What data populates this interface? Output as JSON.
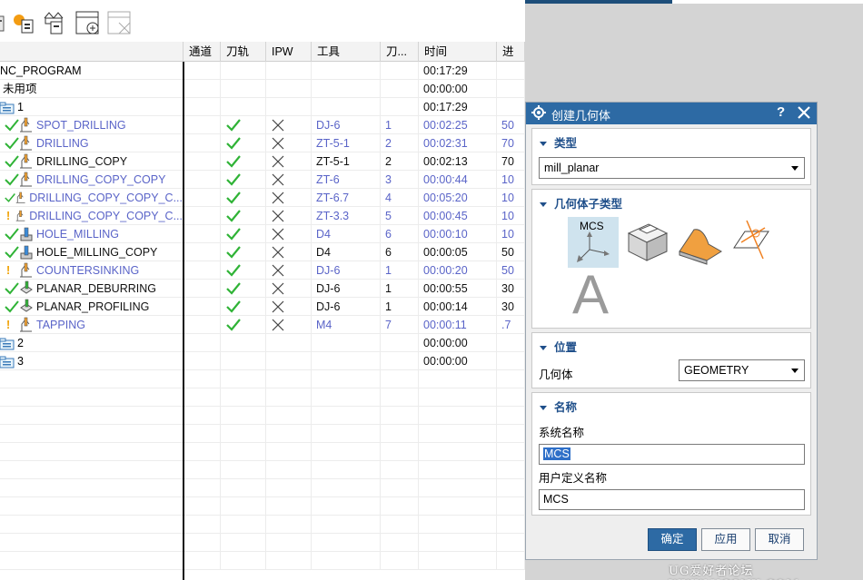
{
  "toolbar": {
    "buttons": [
      {
        "name": "program-view",
        "icon": "program-view-icon"
      },
      {
        "name": "machine-tool-view",
        "icon": "machine-tool-view-icon"
      },
      {
        "name": "geometry-view",
        "icon": "geometry-view-icon"
      },
      {
        "name": "create-geometry",
        "icon": "create-geometry-icon"
      },
      {
        "name": "delete",
        "icon": "delete-icon"
      }
    ]
  },
  "table": {
    "columns": [
      "",
      "通道",
      "刀轨",
      "IPW",
      "工具",
      "刀...",
      "时间",
      "进"
    ],
    "rows": [
      {
        "name": "NC_PROGRAM",
        "type": "root",
        "time": "00:17:29"
      },
      {
        "name": "未用项",
        "type": "unused",
        "time": "00:00:00"
      },
      {
        "name": "1",
        "type": "folder",
        "time": "00:17:29"
      },
      {
        "name": "SPOT_DRILLING",
        "type": "drill",
        "status": "ok",
        "toolpath": true,
        "ipw": true,
        "tool": "DJ-6",
        "tn": "1",
        "time": "00:02:25",
        "next": "50",
        "color": "blue"
      },
      {
        "name": "DRILLING",
        "type": "drill",
        "status": "ok",
        "toolpath": true,
        "ipw": true,
        "tool": "ZT-5-1",
        "tn": "2",
        "time": "00:02:31",
        "next": "70",
        "color": "blue"
      },
      {
        "name": "DRILLING_COPY",
        "type": "drill",
        "status": "ok",
        "toolpath": true,
        "ipw": true,
        "tool": "ZT-5-1",
        "tn": "2",
        "time": "00:02:13",
        "next": "70",
        "color": "black"
      },
      {
        "name": "DRILLING_COPY_COPY",
        "type": "drill",
        "status": "ok",
        "toolpath": true,
        "ipw": true,
        "tool": "ZT-6",
        "tn": "3",
        "time": "00:00:44",
        "next": "10",
        "color": "blue"
      },
      {
        "name": "DRILLING_COPY_COPY_C...",
        "type": "drill",
        "status": "ok",
        "toolpath": true,
        "ipw": true,
        "tool": "ZT-6.7",
        "tn": "4",
        "time": "00:05:20",
        "next": "10",
        "color": "blue"
      },
      {
        "name": "DRILLING_COPY_COPY_C...",
        "type": "drill",
        "status": "warn",
        "toolpath": true,
        "ipw": true,
        "tool": "ZT-3.3",
        "tn": "5",
        "time": "00:00:45",
        "next": "10",
        "color": "blue"
      },
      {
        "name": "HOLE_MILLING",
        "type": "hole",
        "status": "ok",
        "toolpath": true,
        "ipw": true,
        "tool": "D4",
        "tn": "6",
        "time": "00:00:10",
        "next": "10",
        "color": "blue"
      },
      {
        "name": "HOLE_MILLING_COPY",
        "type": "hole",
        "status": "ok",
        "toolpath": true,
        "ipw": true,
        "tool": "D4",
        "tn": "6",
        "time": "00:00:05",
        "next": "50",
        "color": "black"
      },
      {
        "name": "COUNTERSINKING",
        "type": "drill",
        "status": "warn",
        "toolpath": true,
        "ipw": true,
        "tool": "DJ-6",
        "tn": "1",
        "time": "00:00:20",
        "next": "50",
        "color": "blue"
      },
      {
        "name": "PLANAR_DEBURRING",
        "type": "deburr",
        "status": "ok",
        "toolpath": true,
        "ipw": true,
        "tool": "DJ-6",
        "tn": "1",
        "time": "00:00:55",
        "next": "30",
        "color": "black"
      },
      {
        "name": "PLANAR_PROFILING",
        "type": "deburr",
        "status": "ok",
        "toolpath": true,
        "ipw": true,
        "tool": "DJ-6",
        "tn": "1",
        "time": "00:00:14",
        "next": "30",
        "color": "black"
      },
      {
        "name": "TAPPING",
        "type": "drill",
        "status": "warn",
        "toolpath": true,
        "ipw": true,
        "tool": "M4",
        "tn": "7",
        "time": "00:00:11",
        "next": ".7",
        "color": "blue"
      },
      {
        "name": "2",
        "type": "folder",
        "time": "00:00:00"
      },
      {
        "name": "3",
        "type": "folder",
        "time": "00:00:00"
      }
    ]
  },
  "dialog": {
    "title": "创建几何体",
    "help": "?",
    "type_section": {
      "header": "类型",
      "value": "mill_planar"
    },
    "subtype_section": {
      "header": "几何体子类型",
      "mcs_label": "MCS",
      "icons": [
        "mcs-icon",
        "workpiece-icon",
        "mill-area-icon",
        "mill-bnd-icon",
        "text-geometry-icon"
      ],
      "text_icon_letter": "A"
    },
    "location_section": {
      "header": "位置",
      "label": "几何体",
      "value": "GEOMETRY"
    },
    "name_section": {
      "header": "名称",
      "system_name_label": "系统名称",
      "system_name_value": "MCS",
      "user_name_label": "用户定义名称",
      "user_name_value": "MCS"
    },
    "buttons": {
      "ok": "确定",
      "apply": "应用",
      "cancel": "取消"
    }
  },
  "footer": "UG爱好者论坛 WWW.UGSNX.COM",
  "colors": {
    "accent": "#2d6aa4",
    "link": "#5a64c8",
    "check": "#2fb336",
    "warn": "#f0a000"
  }
}
